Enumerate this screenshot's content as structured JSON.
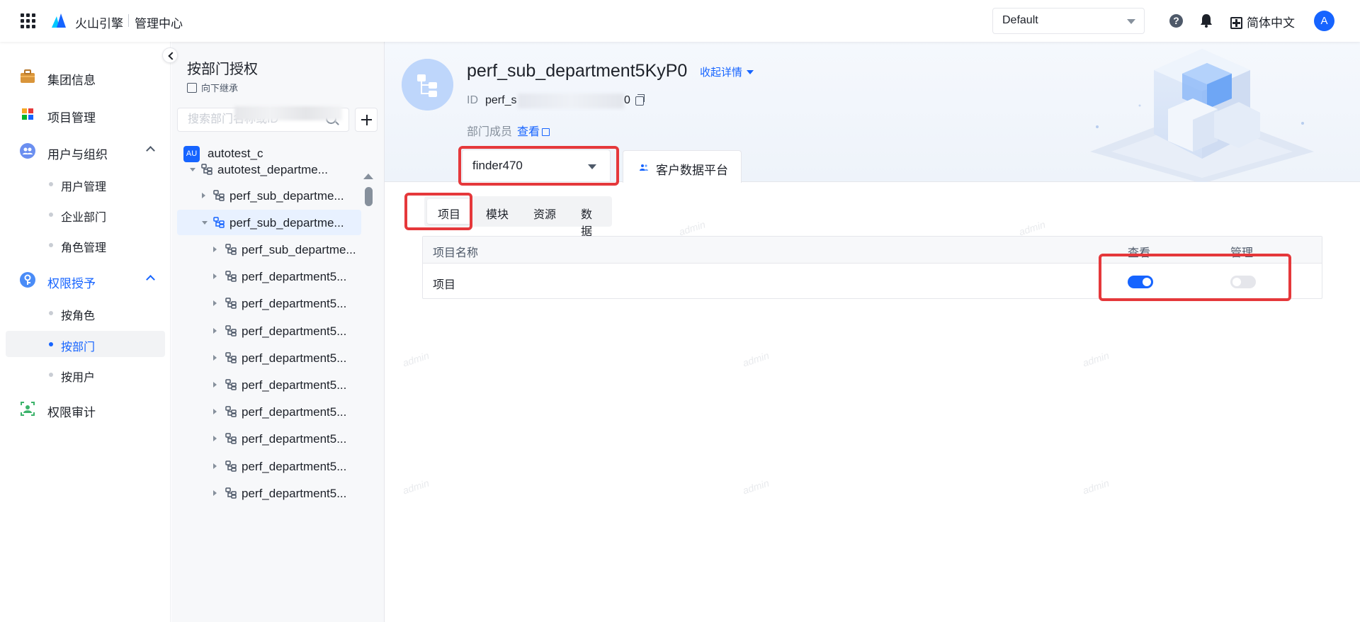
{
  "topbar": {
    "brand": "火山引擎",
    "brand_sub": "管理中心",
    "env_select": "Default",
    "language": "简体中文",
    "avatar_letter": "A"
  },
  "leftnav": {
    "items": [
      {
        "label": "集团信息",
        "icon": "briefcase-icon"
      },
      {
        "label": "项目管理",
        "icon": "project-grid-icon"
      },
      {
        "label": "用户与组织",
        "icon": "users-icon",
        "sub": [
          "用户管理",
          "企业部门",
          "角色管理"
        ]
      },
      {
        "label": "权限授予",
        "icon": "key-icon",
        "sub": [
          "按角色",
          "按部门",
          "按用户"
        ],
        "active_sub": "按部门"
      },
      {
        "label": "权限审计",
        "icon": "audit-icon"
      }
    ]
  },
  "deptpanel": {
    "title": "按部门授权",
    "inherit_label": "向下继承",
    "search_placeholder": "搜索部门名称或ID",
    "root": {
      "badge": "AU",
      "label": "autotest_c"
    },
    "tree": [
      {
        "label": "autotest_departme...",
        "depth": 1,
        "expanded": true,
        "selected": false
      },
      {
        "label": "perf_sub_departme...",
        "depth": 2,
        "expanded": false,
        "selected": false
      },
      {
        "label": "perf_sub_departme...",
        "depth": 2,
        "expanded": true,
        "selected": true
      },
      {
        "label": "perf_sub_departme...",
        "depth": 3,
        "expanded": false,
        "selected": false
      },
      {
        "label": "perf_department5...",
        "depth": 3,
        "expanded": false,
        "selected": false
      },
      {
        "label": "perf_department5...",
        "depth": 3,
        "expanded": false,
        "selected": false
      },
      {
        "label": "perf_department5...",
        "depth": 3,
        "expanded": false,
        "selected": false
      },
      {
        "label": "perf_department5...",
        "depth": 3,
        "expanded": false,
        "selected": false
      },
      {
        "label": "perf_department5...",
        "depth": 3,
        "expanded": false,
        "selected": false
      },
      {
        "label": "perf_department5...",
        "depth": 3,
        "expanded": false,
        "selected": false
      },
      {
        "label": "perf_department5...",
        "depth": 3,
        "expanded": false,
        "selected": false
      },
      {
        "label": "perf_department5...",
        "depth": 3,
        "expanded": false,
        "selected": false
      },
      {
        "label": "perf_department5...",
        "depth": 3,
        "expanded": false,
        "selected": false
      }
    ]
  },
  "detail": {
    "name": "perf_sub_department5KyP0",
    "collapse_label": "收起详情",
    "id_label": "ID",
    "id_value_start": "perf_s",
    "id_value_end": "0",
    "members_label": "部门成员",
    "members_link": "查看"
  },
  "product_select": "finder470",
  "platform_tab": "客户数据平台",
  "subtabs": [
    "项目",
    "模块",
    "资源",
    "数据"
  ],
  "active_subtab": "项目",
  "table": {
    "headers": [
      "项目名称",
      "查看",
      "管理"
    ],
    "rows": [
      {
        "name": "项目",
        "view": true,
        "manage": false
      }
    ]
  },
  "watermark": "admin",
  "colors": {
    "primary": "#1664ff",
    "highlight": "#e5383b",
    "selected_bg": "#e8f1ff"
  }
}
